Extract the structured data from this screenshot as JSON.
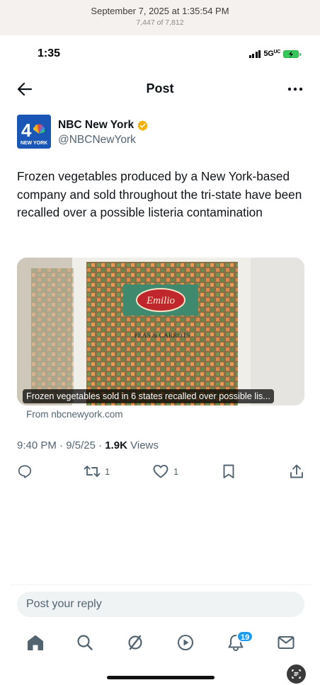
{
  "photo_header": {
    "date": "September 7, 2025 at 1:35:54 PM",
    "count": "7,447 of 7,812"
  },
  "status": {
    "time": "1:35",
    "network": "5G",
    "network_suffix": "UC"
  },
  "nav": {
    "title": "Post"
  },
  "author": {
    "name": "NBC New York",
    "handle": "@NBCNewYork",
    "avatar_text": "4",
    "avatar_subtext": "NEW YORK"
  },
  "post": {
    "text": "Frozen vegetables produced by a New York-based company and sold throughout the tri-state have been recalled over a possible listeria contamination",
    "media_caption": "Frozen vegetables sold in 6 states recalled over possible lis...",
    "media_source": "From nbcnewyork.com",
    "package_brand": "Emilio",
    "package_label": "PEAS & CARROTS",
    "time": "9:40 PM",
    "date": "9/5/25",
    "views_count": "1.9K",
    "views_label": "Views"
  },
  "actions": {
    "reply_count": "",
    "repost_count": "1",
    "like_count": "1"
  },
  "reply": {
    "placeholder": "Post your reply"
  },
  "tabbar": {
    "notification_badge": "19"
  },
  "colors": {
    "accent": "#1d9bf0",
    "verified": "#f4b000",
    "muted": "#536471",
    "battery": "#35c759"
  }
}
